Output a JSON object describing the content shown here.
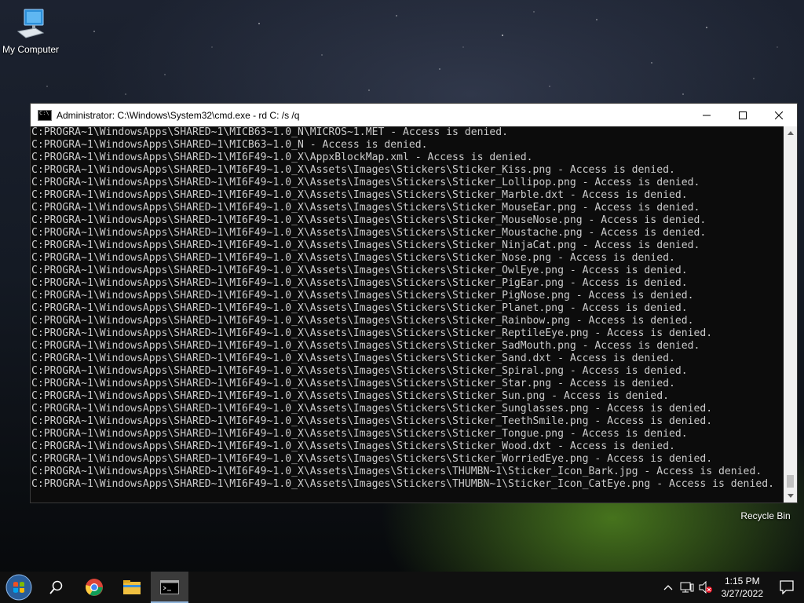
{
  "desktop": {
    "icons": [
      {
        "label": "My Computer"
      },
      {
        "label": "Recycle Bin"
      }
    ]
  },
  "window": {
    "title": "Administrator: C:\\Windows\\System32\\cmd.exe - rd  C: /s /q",
    "lines": [
      "C:PROGRA~1\\WindowsApps\\SHARED~1\\MICB63~1.0_N\\MICROS~1.MET - Access is denied.",
      "C:PROGRA~1\\WindowsApps\\SHARED~1\\MICB63~1.0_N - Access is denied.",
      "C:PROGRA~1\\WindowsApps\\SHARED~1\\MI6F49~1.0_X\\AppxBlockMap.xml - Access is denied.",
      "C:PROGRA~1\\WindowsApps\\SHARED~1\\MI6F49~1.0_X\\Assets\\Images\\Stickers\\Sticker_Kiss.png - Access is denied.",
      "C:PROGRA~1\\WindowsApps\\SHARED~1\\MI6F49~1.0_X\\Assets\\Images\\Stickers\\Sticker_Lollipop.png - Access is denied.",
      "C:PROGRA~1\\WindowsApps\\SHARED~1\\MI6F49~1.0_X\\Assets\\Images\\Stickers\\Sticker_Marble.dxt - Access is denied.",
      "C:PROGRA~1\\WindowsApps\\SHARED~1\\MI6F49~1.0_X\\Assets\\Images\\Stickers\\Sticker_MouseEar.png - Access is denied.",
      "C:PROGRA~1\\WindowsApps\\SHARED~1\\MI6F49~1.0_X\\Assets\\Images\\Stickers\\Sticker_MouseNose.png - Access is denied.",
      "C:PROGRA~1\\WindowsApps\\SHARED~1\\MI6F49~1.0_X\\Assets\\Images\\Stickers\\Sticker_Moustache.png - Access is denied.",
      "C:PROGRA~1\\WindowsApps\\SHARED~1\\MI6F49~1.0_X\\Assets\\Images\\Stickers\\Sticker_NinjaCat.png - Access is denied.",
      "C:PROGRA~1\\WindowsApps\\SHARED~1\\MI6F49~1.0_X\\Assets\\Images\\Stickers\\Sticker_Nose.png - Access is denied.",
      "C:PROGRA~1\\WindowsApps\\SHARED~1\\MI6F49~1.0_X\\Assets\\Images\\Stickers\\Sticker_OwlEye.png - Access is denied.",
      "C:PROGRA~1\\WindowsApps\\SHARED~1\\MI6F49~1.0_X\\Assets\\Images\\Stickers\\Sticker_PigEar.png - Access is denied.",
      "C:PROGRA~1\\WindowsApps\\SHARED~1\\MI6F49~1.0_X\\Assets\\Images\\Stickers\\Sticker_PigNose.png - Access is denied.",
      "C:PROGRA~1\\WindowsApps\\SHARED~1\\MI6F49~1.0_X\\Assets\\Images\\Stickers\\Sticker_Planet.png - Access is denied.",
      "C:PROGRA~1\\WindowsApps\\SHARED~1\\MI6F49~1.0_X\\Assets\\Images\\Stickers\\Sticker_Rainbow.png - Access is denied.",
      "C:PROGRA~1\\WindowsApps\\SHARED~1\\MI6F49~1.0_X\\Assets\\Images\\Stickers\\Sticker_ReptileEye.png - Access is denied.",
      "C:PROGRA~1\\WindowsApps\\SHARED~1\\MI6F49~1.0_X\\Assets\\Images\\Stickers\\Sticker_SadMouth.png - Access is denied.",
      "C:PROGRA~1\\WindowsApps\\SHARED~1\\MI6F49~1.0_X\\Assets\\Images\\Stickers\\Sticker_Sand.dxt - Access is denied.",
      "C:PROGRA~1\\WindowsApps\\SHARED~1\\MI6F49~1.0_X\\Assets\\Images\\Stickers\\Sticker_Spiral.png - Access is denied.",
      "C:PROGRA~1\\WindowsApps\\SHARED~1\\MI6F49~1.0_X\\Assets\\Images\\Stickers\\Sticker_Star.png - Access is denied.",
      "C:PROGRA~1\\WindowsApps\\SHARED~1\\MI6F49~1.0_X\\Assets\\Images\\Stickers\\Sticker_Sun.png - Access is denied.",
      "C:PROGRA~1\\WindowsApps\\SHARED~1\\MI6F49~1.0_X\\Assets\\Images\\Stickers\\Sticker_Sunglasses.png - Access is denied.",
      "C:PROGRA~1\\WindowsApps\\SHARED~1\\MI6F49~1.0_X\\Assets\\Images\\Stickers\\Sticker_TeethSmile.png - Access is denied.",
      "C:PROGRA~1\\WindowsApps\\SHARED~1\\MI6F49~1.0_X\\Assets\\Images\\Stickers\\Sticker_Tongue.png - Access is denied.",
      "C:PROGRA~1\\WindowsApps\\SHARED~1\\MI6F49~1.0_X\\Assets\\Images\\Stickers\\Sticker_Wood.dxt - Access is denied.",
      "C:PROGRA~1\\WindowsApps\\SHARED~1\\MI6F49~1.0_X\\Assets\\Images\\Stickers\\Sticker_WorriedEye.png - Access is denied.",
      "C:PROGRA~1\\WindowsApps\\SHARED~1\\MI6F49~1.0_X\\Assets\\Images\\Stickers\\THUMBN~1\\Sticker_Icon_Bark.jpg - Access is denied.",
      "C:PROGRA~1\\WindowsApps\\SHARED~1\\MI6F49~1.0_X\\Assets\\Images\\Stickers\\THUMBN~1\\Sticker_Icon_CatEye.png - Access is denied."
    ]
  },
  "taskbar": {
    "items": [
      {
        "icon": "start-orb-icon"
      },
      {
        "icon": "search-icon"
      },
      {
        "icon": "chrome-icon"
      },
      {
        "icon": "file-explorer-icon"
      },
      {
        "icon": "cmd-icon"
      }
    ],
    "clock": {
      "time": "1:15 PM",
      "date": "3/27/2022"
    }
  },
  "colors": {
    "console_bg": "#0c0c0c",
    "console_fg": "#cccccc",
    "taskbar_bg": "#101010",
    "accent": "#8fb3d9"
  }
}
